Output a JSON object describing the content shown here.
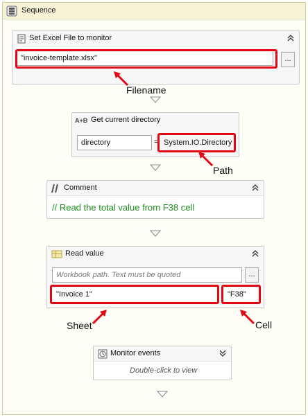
{
  "sequence": {
    "title": "Sequence"
  },
  "set_excel": {
    "title": "Set Excel File to monitor",
    "value": "\"invoice-template.xlsx\"",
    "browse": "..."
  },
  "get_dir": {
    "badge": "A+B",
    "title": "Get current directory",
    "left": "directory",
    "equals": "=",
    "right": "System.IO.Directory"
  },
  "comment": {
    "title": "Comment",
    "text": "// Read the total value from F38 cell"
  },
  "read_value": {
    "title": "Read value",
    "workbook_placeholder": "Workbook path. Text must be quoted",
    "browse": "...",
    "sheet": "\"Invoice 1\"",
    "cell": "\"F38\""
  },
  "monitor": {
    "title": "Monitor events",
    "hint": "Double-click to view"
  },
  "annotations": {
    "filename": "Filename",
    "path": "Path",
    "sheet": "Sheet",
    "cell": "Cell"
  },
  "colors": {
    "highlight": "#e30613",
    "comment_text": "#1f8a1f",
    "frame_border": "#d7cf9a",
    "frame_header": "#f7f3d6"
  }
}
